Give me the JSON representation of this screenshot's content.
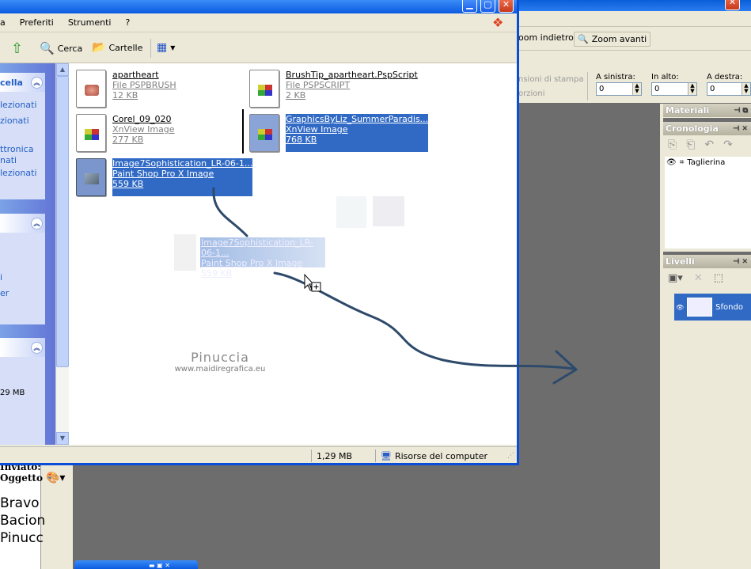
{
  "explorer": {
    "menu": [
      "a",
      "Preferiti",
      "Strumenti",
      "?"
    ],
    "toolbar": {
      "search": "Cerca",
      "folders": "Cartelle"
    },
    "taskpane": {
      "panel1_title": "cella",
      "panel1_links": [
        "lezionati",
        "zionati",
        "ttronica",
        "nati",
        "lezionati"
      ],
      "panel3_value": "29 MB"
    },
    "files": [
      {
        "name": "apartheart",
        "type": "File PSPBRUSH",
        "size": "12 KB"
      },
      {
        "name": "BrushTip_apartheart.PspScript",
        "type": "File PSPSCRIPT",
        "size": "2 KB"
      },
      {
        "name": "Corel_09_020",
        "type": "XnView Image",
        "size": "277 KB"
      },
      {
        "name": "GraphicsByLiz_SummerParadis...",
        "type": "XnView Image",
        "size": "768 KB"
      },
      {
        "name": "Image7Sophistication_LR-06-1...",
        "type": "Paint Shop Pro X Image",
        "size": "559 KB"
      }
    ],
    "drag_ghost": {
      "name": "Image7Sophistication_LR-06-1...",
      "type": "Paint Shop Pro X Image",
      "size": "559 KB"
    },
    "status": {
      "size": "1,29 MB",
      "location": "Risorse del computer"
    },
    "watermark": {
      "line1": "Pinuccia",
      "line2": "www.maidiregrafica.eu"
    }
  },
  "psp": {
    "toolbar": {
      "zoom_back": "oom indietro",
      "zoom_forward": "Zoom avanti"
    },
    "options": {
      "faded1": "nsioni di stampa",
      "faded2": "orzioni",
      "left_label": "A sinistra:",
      "top_label": "In alto:",
      "right_label": "A destra:",
      "left_value": "0",
      "top_value": "0",
      "right_value": "0"
    },
    "palettes": {
      "materials": "Materiali",
      "history": "Cronologia",
      "history_item": "Taglierina",
      "layers": "Livelli",
      "layer_name": "Sfondo"
    }
  },
  "bg_text": {
    "email_fields": [
      "Inviato:",
      "Oggetto"
    ],
    "body_lines": [
      "Bravo",
      "Bacion",
      "Pinucc"
    ]
  },
  "colors": {
    "xp_blue": "#0a5fd8",
    "selection": "#316ac5",
    "arrow": "#2d4a6b",
    "canvas_gray": "#6d6d6d"
  }
}
